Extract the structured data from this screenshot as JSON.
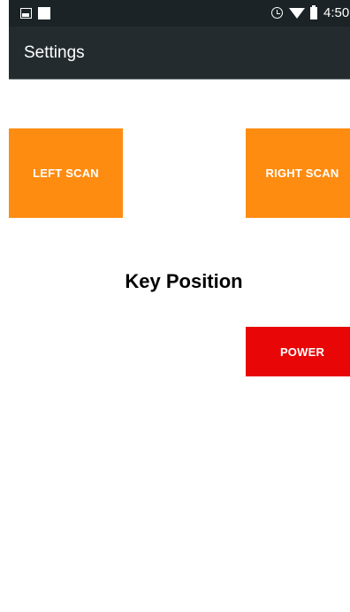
{
  "status_bar": {
    "time": "4:50",
    "icons": [
      "image-icon",
      "square-icon",
      "alarm-icon",
      "wifi-icon",
      "battery-icon"
    ]
  },
  "app_bar": {
    "title": "Settings"
  },
  "main": {
    "heading": "Key Position",
    "buttons": {
      "left_scan": "LEFT SCAN",
      "right_scan": "RIGHT SCAN",
      "power": "POWER"
    }
  },
  "colors": {
    "status_bar_bg": "#1b2326",
    "app_bar_bg": "#232b2f",
    "scan_button": "#fe8c11",
    "power_button": "#e80606",
    "text_on_button": "#ffffff"
  }
}
